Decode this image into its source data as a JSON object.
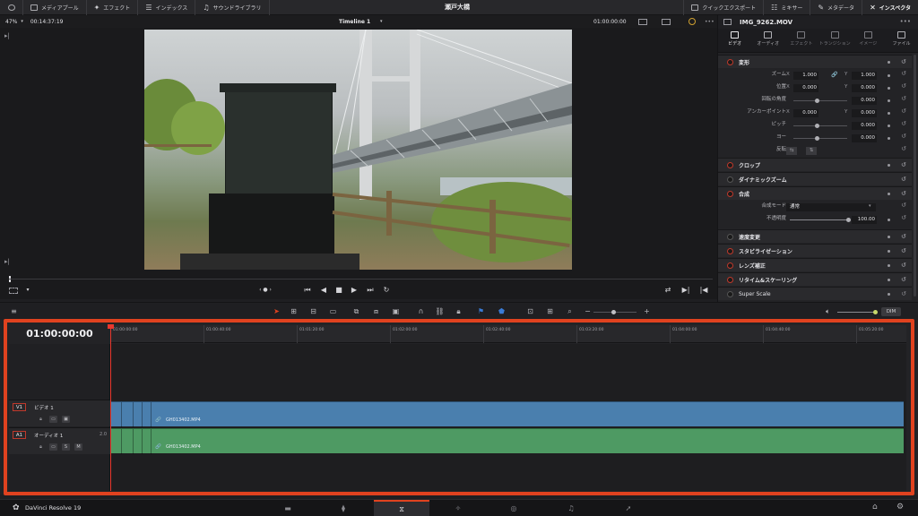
{
  "topbar": {
    "media_pool": "メディアプール",
    "effects": "エフェクト",
    "index": "インデックス",
    "sound_library": "サウンドライブラリ",
    "project_title": "瀬戸大橋",
    "quick_export": "クイックエクスポート",
    "mixer": "ミキサー",
    "metadata": "メタデータ",
    "inspector": "インスペクタ"
  },
  "viewer": {
    "zoom": "47%",
    "source_timecode": "00:14:37:19",
    "timeline_name": "Timeline 1",
    "record_timecode": "01:00:00:00"
  },
  "inspector": {
    "clip_name": "IMG_9262.MOV",
    "tabs": [
      "ビデオ",
      "オーディオ",
      "エフェクト",
      "トランジション",
      "イメージ",
      "ファイル"
    ],
    "transform_title": "変形",
    "zoom_label": "ズーム",
    "position_label": "位置",
    "rotation_label": "回転の角度",
    "anchor_label": "アンカーポイント",
    "pitch_label": "ピッチ",
    "yaw_label": "ヨー",
    "flip_label": "反転",
    "x": "X",
    "y": "Y",
    "zoom_x": "1.000",
    "zoom_y": "1.000",
    "pos_x": "0.000",
    "pos_y": "0.000",
    "rotation": "0.000",
    "anchor_x": "0.000",
    "anchor_y": "0.000",
    "pitch": "0.000",
    "yaw": "0.000",
    "crop": "クロップ",
    "dynamic_zoom": "ダイナミックズーム",
    "composite": "合成",
    "composite_mode_label": "合成モード",
    "composite_mode_value": "通常",
    "opacity_label": "不透明度",
    "opacity_value": "100.00",
    "speed_change": "速度変更",
    "stabilization": "スタビライゼーション",
    "lens_correction": "レンズ補正",
    "retime_scaling": "リタイム&スケーリング",
    "super_scale": "Super Scale"
  },
  "toolbar": {
    "dim": "DIM"
  },
  "timeline": {
    "timecode": "01:00:00:00",
    "ruler": [
      "01:00:00:00",
      "01:00:40:00",
      "01:01:20:00",
      "01:02:00:00",
      "01:02:40:00",
      "01:03:20:00",
      "01:04:00:00",
      "01:04:40:00",
      "01:05:20:00"
    ],
    "v1_tag": "V1",
    "v1_name": "ビデオ 1",
    "a1_tag": "A1",
    "a1_name": "オーディオ 1",
    "a1_channels": "2.0",
    "solo": "S",
    "mute": "M",
    "video_clip": "GH013402.MP4",
    "audio_clip": "GH013402.MP4"
  },
  "bottom": {
    "app_name": "DaVinci Resolve 19"
  }
}
